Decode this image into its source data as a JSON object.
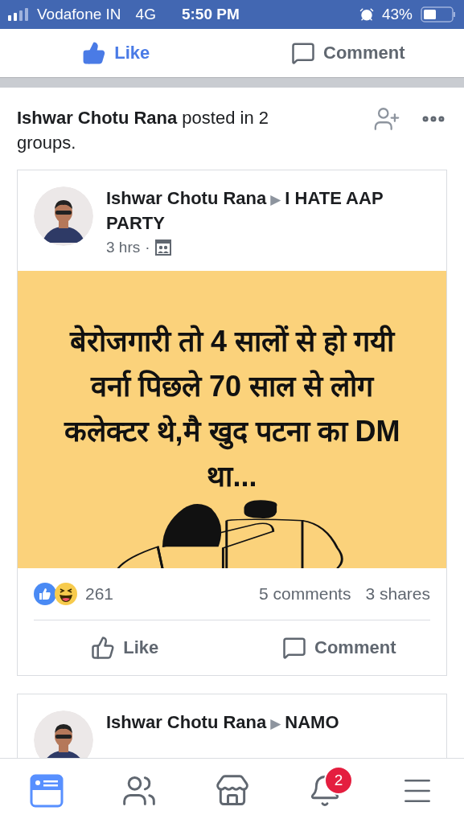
{
  "status_bar": {
    "carrier": "Vodafone IN",
    "network": "4G",
    "time": "5:50 PM",
    "battery": "43%"
  },
  "top_actions": [
    {
      "kind": "like",
      "label": "Like",
      "selected": true
    },
    {
      "kind": "comment",
      "label": "Comment",
      "selected": false
    }
  ],
  "story": {
    "headline": "**Ishwar Chotu Rana** posted in 2 groups."
  },
  "posts": [
    {
      "author": "Ishwar Chotu Rana",
      "arrow": "▶",
      "group": "I HATE AAP PARTY",
      "time": "3 hrs",
      "separator": "·",
      "body": "बेरोजगारी तो 4 सालों से हो गयी वर्ना पिछले 70 साल से लोग कलेक्टर थे,मै खुद पटना  का DM था...",
      "reactions": "261",
      "comments": "5 comments",
      "shares": "3 shares",
      "actions": [
        {
          "kind": "like",
          "label": "Like",
          "selected": false
        },
        {
          "kind": "comment",
          "label": "Comment",
          "selected": false
        }
      ]
    },
    {
      "author": "Ishwar Chotu Rana",
      "arrow": "▶",
      "group": "NAMO"
    }
  ],
  "tabs": [
    {
      "kind": "feed",
      "selected": true
    },
    {
      "kind": "friends",
      "selected": false
    },
    {
      "kind": "marketplace",
      "selected": false
    },
    {
      "kind": "notifications",
      "selected": false,
      "badge": "2"
    },
    {
      "kind": "menu",
      "selected": false
    }
  ]
}
